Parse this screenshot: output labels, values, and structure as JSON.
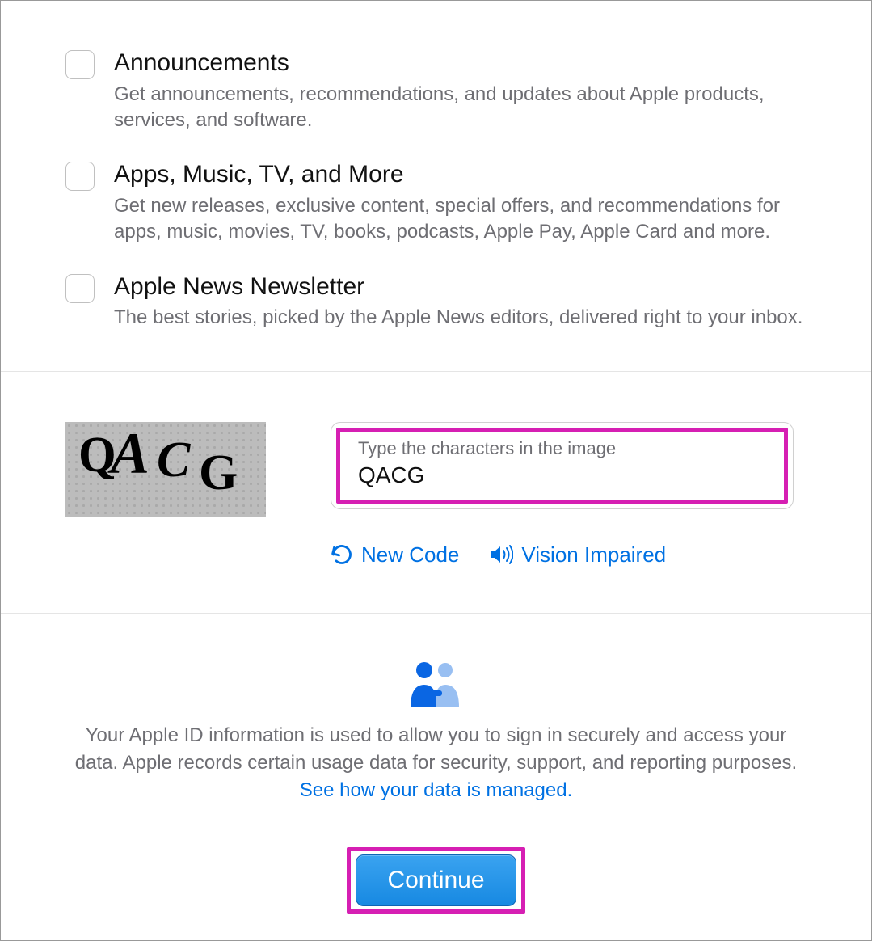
{
  "prefs": [
    {
      "title": "Announcements",
      "desc": "Get announcements, recommendations, and updates about Apple products, services, and software."
    },
    {
      "title": "Apps, Music, TV, and More",
      "desc": "Get new releases, exclusive content, special offers, and recommendations for apps, music, movies, TV, books, podcasts, Apple Pay, Apple Card and more."
    },
    {
      "title": "Apple News Newsletter",
      "desc": "The best stories, picked by the Apple News editors, delivered right to your inbox."
    }
  ],
  "captcha": {
    "image_text": "QACG",
    "input_label": "Type the characters in the image",
    "input_value": "QACG",
    "new_code_label": "New Code",
    "vision_impaired_label": "Vision Impaired"
  },
  "footer": {
    "privacy_text": "Your Apple ID information is used to allow you to sign in securely and access your data. Apple records certain usage data for security, support, and reporting purposes. ",
    "privacy_link": "See how your data is managed.",
    "continue_label": "Continue"
  }
}
